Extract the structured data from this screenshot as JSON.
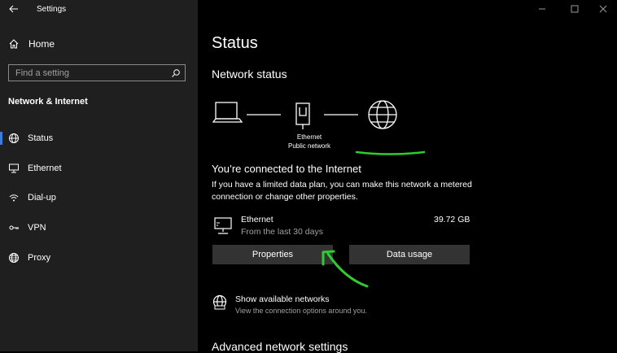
{
  "window": {
    "title": "Settings"
  },
  "sidebar": {
    "home_label": "Home",
    "search_placeholder": "Find a setting",
    "section_title": "Network & Internet",
    "items": [
      {
        "label": "Status",
        "icon": "globe-network-icon",
        "active": true
      },
      {
        "label": "Ethernet",
        "icon": "ethernet-icon"
      },
      {
        "label": "Dial-up",
        "icon": "dialup-icon"
      },
      {
        "label": "VPN",
        "icon": "vpn-icon"
      },
      {
        "label": "Proxy",
        "icon": "proxy-globe-icon"
      }
    ]
  },
  "main": {
    "title": "Status",
    "network_status_title": "Network status",
    "diagram": {
      "connection_name": "Ethernet",
      "connection_type": "Public network"
    },
    "connected_heading": "You’re connected to the Internet",
    "connected_desc": "If you have a limited data plan, you can make this network a metered connection or change other properties.",
    "adapter": {
      "name": "Ethernet",
      "period": "From the last 30 days",
      "usage": "39.72 GB"
    },
    "buttons": {
      "properties": "Properties",
      "data_usage": "Data usage"
    },
    "show_networks": {
      "title": "Show available networks",
      "subtitle": "View the connection options around you."
    },
    "advanced_title": "Advanced network settings"
  },
  "colors": {
    "accent": "#3b7ddd",
    "annotation": "#2ecc2e",
    "button_bg": "#333333",
    "sidebar_bg": "#1f1f1f"
  }
}
